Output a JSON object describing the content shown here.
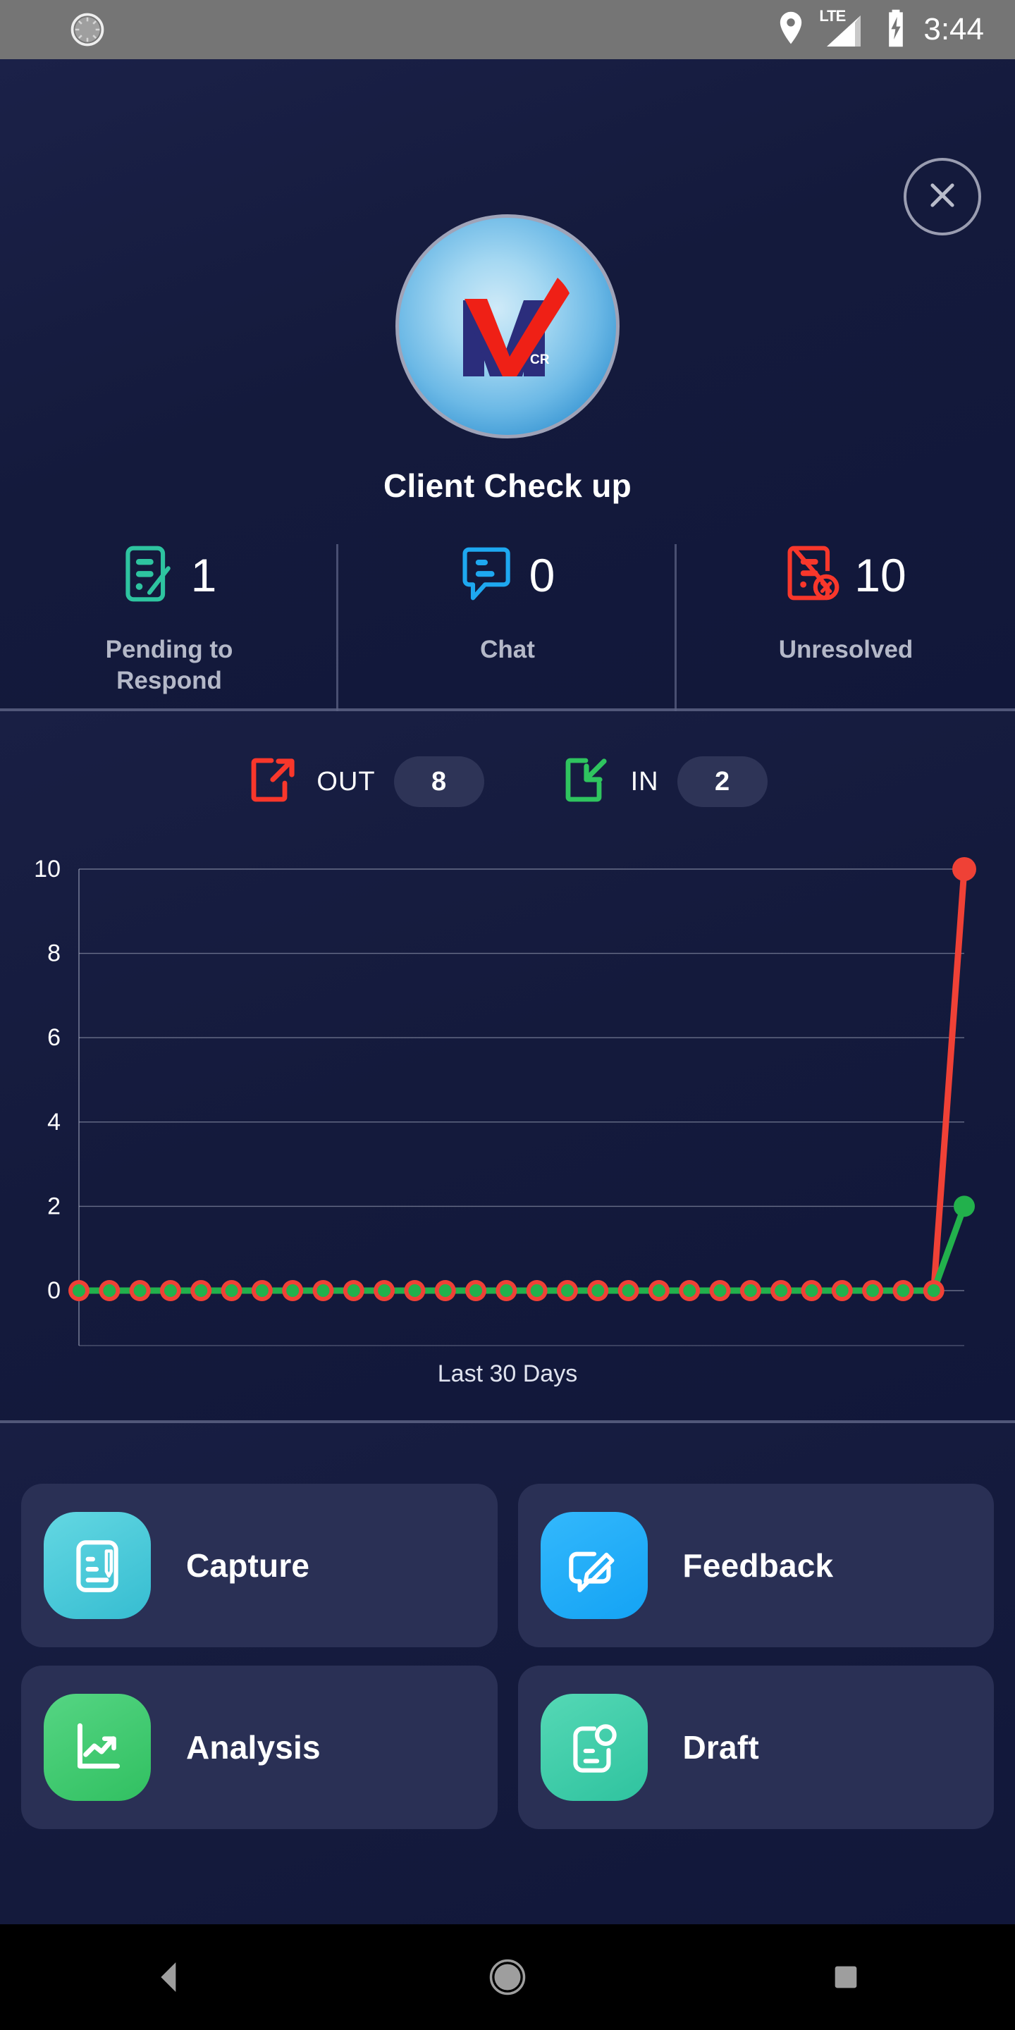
{
  "status_bar": {
    "spinner_icon": "sync-spinner-icon",
    "location_icon": "location-pin-icon",
    "network_label": "LTE",
    "signal_icon": "signal-bars-icon",
    "battery_icon": "battery-charging-icon",
    "time": "3:44"
  },
  "header": {
    "close_icon": "close-icon",
    "logo_icon": "mcr-logo-icon",
    "logo_letter": "M",
    "logo_sub": "CR",
    "title": "Client Check up"
  },
  "stats": [
    {
      "icon": "document-edit-icon",
      "value": "1",
      "label": "Pending to Respond",
      "color": "#2ec4a0"
    },
    {
      "icon": "chat-bubble-icon",
      "value": "0",
      "label": "Chat",
      "color": "#1ea8f0"
    },
    {
      "icon": "document-x-icon",
      "value": "10",
      "label": "Unresolved",
      "color": "#f8372b"
    }
  ],
  "traffic": [
    {
      "icon": "arrow-out-icon",
      "label": "OUT",
      "value": "8",
      "color": "#f8372b"
    },
    {
      "icon": "arrow-in-icon",
      "label": "IN",
      "value": "2",
      "color": "#2fc45f"
    }
  ],
  "chart_data": {
    "type": "line",
    "title": "",
    "xlabel": "Last 30 Days",
    "ylabel": "",
    "ylim": [
      0,
      10
    ],
    "yticks": [
      0,
      2,
      4,
      6,
      8,
      10
    ],
    "grid": true,
    "legend": "none",
    "x": [
      1,
      2,
      3,
      4,
      5,
      6,
      7,
      8,
      9,
      10,
      11,
      12,
      13,
      14,
      15,
      16,
      17,
      18,
      19,
      20,
      21,
      22,
      23,
      24,
      25,
      26,
      27,
      28,
      29,
      30
    ],
    "series": [
      {
        "name": "OUT",
        "color": "#ef4136",
        "marker_color": "#ef4136",
        "values": [
          0,
          0,
          0,
          0,
          0,
          0,
          0,
          0,
          0,
          0,
          0,
          0,
          0,
          0,
          0,
          0,
          0,
          0,
          0,
          0,
          0,
          0,
          0,
          0,
          0,
          0,
          0,
          0,
          0,
          10
        ]
      },
      {
        "name": "IN",
        "color": "#22b14c",
        "marker_color": "#22b14c",
        "values": [
          0,
          0,
          0,
          0,
          0,
          0,
          0,
          0,
          0,
          0,
          0,
          0,
          0,
          0,
          0,
          0,
          0,
          0,
          0,
          0,
          0,
          0,
          0,
          0,
          0,
          0,
          0,
          0,
          0,
          2
        ]
      }
    ]
  },
  "actions": [
    {
      "icon": "capture-document-pencil-icon",
      "label": "Capture",
      "color_a": "#5fd3e0",
      "color_b": "#3ec2d4"
    },
    {
      "icon": "feedback-chat-pencil-icon",
      "label": "Feedback",
      "color_a": "#2cb4fb",
      "color_b": "#18a6f5"
    },
    {
      "icon": "analysis-chart-icon",
      "label": "Analysis",
      "color_a": "#4fd07c",
      "color_b": "#35c264"
    },
    {
      "icon": "draft-document-icon",
      "label": "Draft",
      "color_a": "#4fd3b0",
      "color_b": "#34c5a2"
    }
  ],
  "navigation": {
    "back_icon": "nav-back-icon",
    "home_icon": "nav-home-icon",
    "recents_icon": "nav-recents-icon"
  }
}
